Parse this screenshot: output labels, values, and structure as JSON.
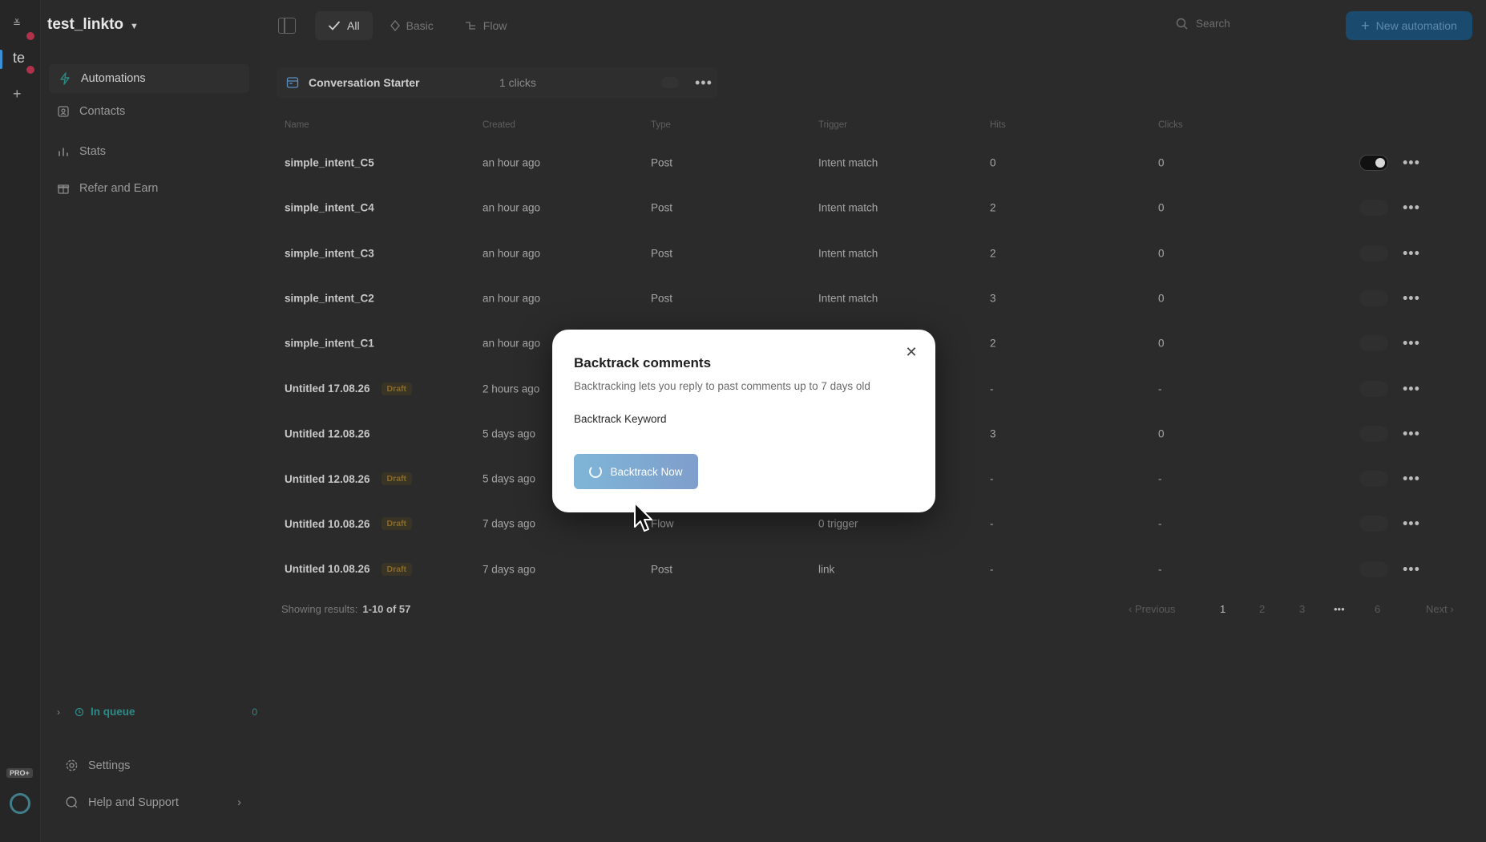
{
  "workspace": {
    "short": "te",
    "name": "test_linkto"
  },
  "sidebar": {
    "items": [
      {
        "label": "Automations",
        "icon": "lightning-icon"
      },
      {
        "label": "Contacts",
        "icon": "contact-card-icon"
      },
      {
        "label": "Stats",
        "icon": "bar-chart-icon"
      },
      {
        "label": "Refer and Earn",
        "icon": "gift-icon"
      }
    ],
    "queue": {
      "label": "In queue",
      "count": "0"
    },
    "settings_label": "Settings",
    "help_label": "Help and Support",
    "pro_badge": "PRO+"
  },
  "topbar": {
    "tabs": [
      {
        "label": "All",
        "icon": "check-icon"
      },
      {
        "label": "Basic",
        "icon": "diamond-icon"
      },
      {
        "label": "Flow",
        "icon": "flow-icon"
      }
    ],
    "search_placeholder": "Search",
    "new_button": "New automation"
  },
  "starter": {
    "title": "Conversation Starter",
    "clicks": "1 clicks"
  },
  "table": {
    "columns": {
      "name": "Name",
      "created": "Created",
      "type": "Type",
      "trigger": "Trigger",
      "hits": "Hits",
      "clicks": "Clicks"
    },
    "rows": [
      {
        "name": "simple_intent_C5",
        "draft": "",
        "created": "an hour ago",
        "type": "Post",
        "trigger": "Intent match",
        "hits": "0",
        "clicks": "0",
        "enabled": true
      },
      {
        "name": "simple_intent_C4",
        "draft": "",
        "created": "an hour ago",
        "type": "Post",
        "trigger": "Intent match",
        "hits": "2",
        "clicks": "0",
        "enabled": false
      },
      {
        "name": "simple_intent_C3",
        "draft": "",
        "created": "an hour ago",
        "type": "Post",
        "trigger": "Intent match",
        "hits": "2",
        "clicks": "0",
        "enabled": false
      },
      {
        "name": "simple_intent_C2",
        "draft": "",
        "created": "an hour ago",
        "type": "Post",
        "trigger": "Intent match",
        "hits": "3",
        "clicks": "0",
        "enabled": false
      },
      {
        "name": "simple_intent_C1",
        "draft": "",
        "created": "an hour ago",
        "type": "",
        "trigger": "",
        "hits": "2",
        "clicks": "0",
        "enabled": false
      },
      {
        "name": "Untitled 17.08.26",
        "draft": "Draft",
        "created": "2 hours ago",
        "type": "",
        "trigger": "",
        "hits": "-",
        "clicks": "-",
        "enabled": false
      },
      {
        "name": "Untitled 12.08.26",
        "draft": "",
        "created": "5 days ago",
        "type": "",
        "trigger": "",
        "hits": "3",
        "clicks": "0",
        "enabled": false
      },
      {
        "name": "Untitled 12.08.26",
        "draft": "Draft",
        "created": "5 days ago",
        "type": "",
        "trigger": "",
        "hits": "-",
        "clicks": "-",
        "enabled": false
      },
      {
        "name": "Untitled 10.08.26",
        "draft": "Draft",
        "created": "7 days ago",
        "type": "Flow",
        "trigger": "0 trigger",
        "hits": "-",
        "clicks": "-",
        "enabled": false
      },
      {
        "name": "Untitled 10.08.26",
        "draft": "Draft",
        "created": "7 days ago",
        "type": "Post",
        "trigger": "link",
        "hits": "-",
        "clicks": "-",
        "enabled": false
      }
    ]
  },
  "footer": {
    "showing_label": "Showing results:",
    "showing_value": "1-10 of 57",
    "pagination": {
      "previous": "Previous",
      "pages": [
        "1",
        "2",
        "3",
        "•••",
        "6"
      ],
      "next": "Next",
      "current": "1"
    }
  },
  "modal": {
    "title": "Backtrack comments",
    "subtitle": "Backtracking lets you reply to past comments up to 7 days old",
    "keyword_label": "Backtrack Keyword",
    "button_label": "Backtrack Now"
  }
}
